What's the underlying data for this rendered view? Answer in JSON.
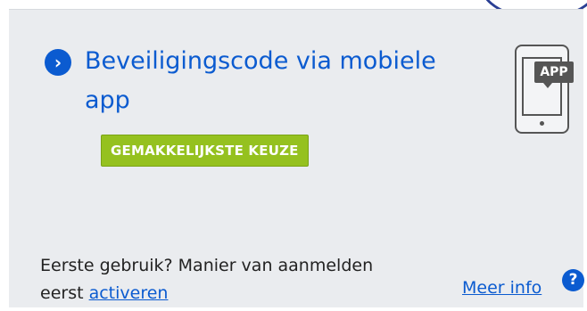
{
  "card": {
    "title_line1": "Beveiligingscode via mobiele",
    "title_line2": "app",
    "badge": "GEMAKKELIJKSTE KEUZE",
    "phone_label": "APP",
    "first_use_text": "Eerste gebruik? Manier van aanmelden",
    "first_use_prefix": "eerst ",
    "activate_link": "activeren",
    "more_info_link": "Meer info",
    "help_icon_text": "?"
  },
  "colors": {
    "accent_blue": "#0b5bd0",
    "badge_green": "#95c11f",
    "card_bg": "#eaecef",
    "border_navy": "#2a3f94"
  },
  "icons": {
    "title_icon": "chevron-right-circle-icon",
    "phone_icon": "mobile-app-icon",
    "help_icon": "question-circle-icon"
  }
}
